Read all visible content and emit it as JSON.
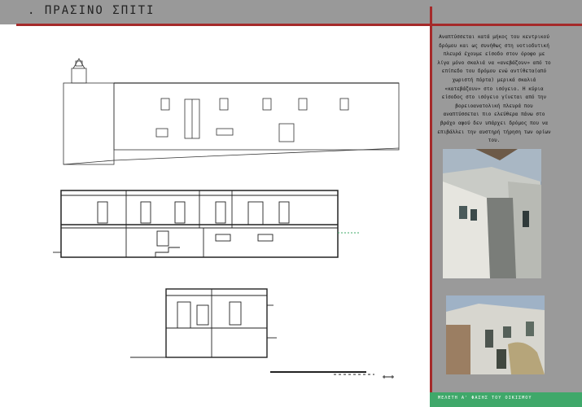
{
  "header": {
    "title": ". ΠΡΑΣΙΝΟ ΣΠΙΤΙ"
  },
  "description": "Αναπτύσσεται  κατά μήκος του κεντρικού δρόμου και ως συνήθως στη νοτιοδυτική πλευρά έχουμε είσοδο στον όροφο με λίγα μόνο σκαλιά να «ανεβάζουν» από το επίπεδο του δρόμου ενώ αντίθετα(από χωριστή πόρτα) μερικά σκαλιά «κατεβάζουν» στο ισόγειο. Η κύρια είσοδος στο ισόγειο γίνεται από την βορειοανατολική πλευρά που αναπτύσσεται πιο ελεύθερα πάνω στο βράχο αφού δεν υπάρχει δρόμος που να επιβάλλει την αυστηρή τήρηση των ορίων του.",
  "footer": {
    "label": "ΜΕΛΕΤΗ Α' ΦΑΣΗΣ ΤΟΥ ΟΙΚΙΣΜΟΥ"
  },
  "colors": {
    "header_bar": "#999999",
    "accent_red": "#a52a2a",
    "side_panel": "#9a9a9a",
    "footer_green": "#3fa86a"
  },
  "photos": [
    {
      "subject": "whitewashed-alley-street"
    },
    {
      "subject": "weathered-house-facade"
    }
  ]
}
